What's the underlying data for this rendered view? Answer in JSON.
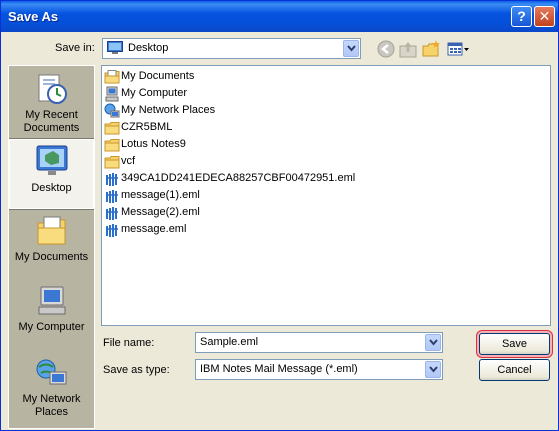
{
  "window": {
    "title": "Save As"
  },
  "titlebar": {
    "help_glyph": "?",
    "close_glyph": "✕"
  },
  "save_in": {
    "label": "Save in:",
    "value": "Desktop",
    "icon": "desktop-icon"
  },
  "toolbar": {
    "icons": [
      "back-icon",
      "up-folder-icon",
      "new-folder-icon",
      "views-menu-icon"
    ]
  },
  "places": [
    {
      "label": "My Recent Documents",
      "icon": "recent-documents-icon"
    },
    {
      "label": "Desktop",
      "icon": "desktop-icon",
      "selected": true
    },
    {
      "label": "My Documents",
      "icon": "my-documents-icon"
    },
    {
      "label": "My Computer",
      "icon": "my-computer-icon"
    },
    {
      "label": "My Network Places",
      "icon": "network-places-icon"
    }
  ],
  "files": [
    {
      "name": "My Documents",
      "icon": "folder-docs"
    },
    {
      "name": "My Computer",
      "icon": "computer"
    },
    {
      "name": "My Network Places",
      "icon": "network"
    },
    {
      "name": "CZR5BML",
      "icon": "folder"
    },
    {
      "name": "Lotus Notes9",
      "icon": "folder"
    },
    {
      "name": "vcf",
      "icon": "folder"
    },
    {
      "name": "349CA1DD241EDECA88257CBF00472951.eml",
      "icon": "eml"
    },
    {
      "name": "message(1).eml",
      "icon": "eml"
    },
    {
      "name": "Message(2).eml",
      "icon": "eml"
    },
    {
      "name": "message.eml",
      "icon": "eml"
    }
  ],
  "file_name": {
    "label": "File name:",
    "value": "Sample.eml"
  },
  "save_as_type": {
    "label": "Save as type:",
    "value": "IBM Notes Mail Message (*.eml)"
  },
  "buttons": {
    "save": "Save",
    "cancel": "Cancel"
  },
  "colors": {
    "title_bar": "#0653e0",
    "dialog_bg": "#ece9d8",
    "places_bg": "#b8b4a2",
    "highlight": "#d8313f"
  }
}
